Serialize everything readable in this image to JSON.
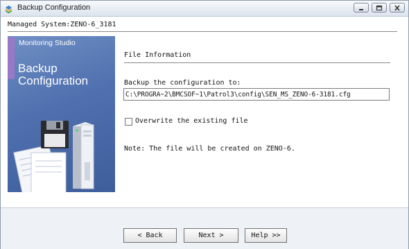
{
  "window": {
    "title": "Backup Configuration"
  },
  "header": {
    "managed_system": "Managed System:ZENO-6_3181"
  },
  "banner": {
    "subtitle": "Monitoring Studio",
    "title_line1": "Backup",
    "title_line2": "Configuration"
  },
  "main": {
    "section_title": "File Information",
    "path_label": "Backup the configuration to:",
    "path_value": "C:\\PROGRA~2\\BMCSOF~1\\Patrol3\\config\\SEN_MS_ZENO-6-3181.cfg",
    "overwrite_label": "Overwrite the existing file",
    "overwrite_checked": false,
    "note": "Note: The file will be created on ZENO-6."
  },
  "footer": {
    "back_label": "< Back",
    "next_label": "Next >",
    "help_label": "Help >>"
  },
  "colors": {
    "banner": "#4f6fae",
    "banner_stripe": "#9a78c8",
    "window_frame": "#eef1f6"
  }
}
